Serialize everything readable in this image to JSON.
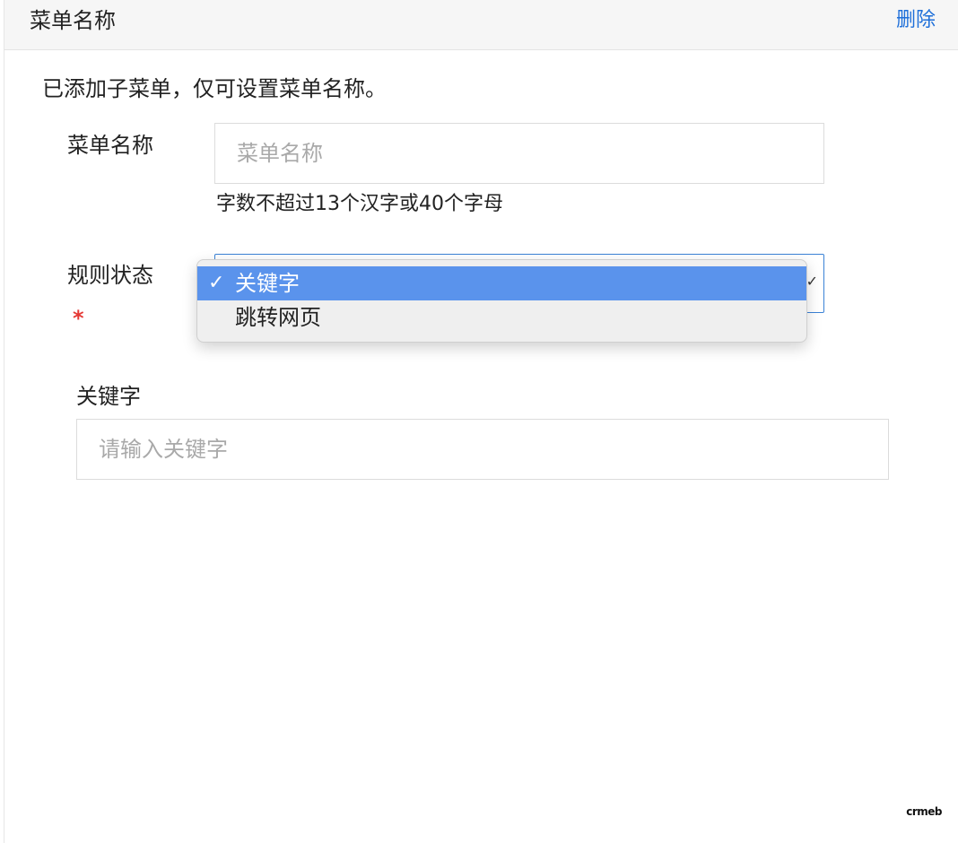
{
  "header": {
    "title": "菜单名称",
    "delete_label": "删除"
  },
  "notice": "已添加子菜单，仅可设置菜单名称。",
  "menu_name": {
    "label": "菜单名称",
    "value": "",
    "placeholder": "菜单名称",
    "hint": "字数不超过13个汉字或40个字母"
  },
  "rule_status": {
    "label": "规则状态",
    "required_mark": "*",
    "selected": "关键字",
    "options": [
      {
        "label": "关键字",
        "selected": true
      },
      {
        "label": "跳转网页",
        "selected": false
      }
    ]
  },
  "keyword": {
    "label": "关键字",
    "value": "",
    "placeholder": "请输入关键字"
  },
  "logo_text": "crmeb",
  "colors": {
    "accent": "#1e6fd9",
    "option_highlight": "#5a93ec",
    "required": "#e53935",
    "header_bg": "#f6f6f6"
  },
  "icons": {
    "check": "check-icon",
    "chevron": "chevron-down-icon"
  }
}
